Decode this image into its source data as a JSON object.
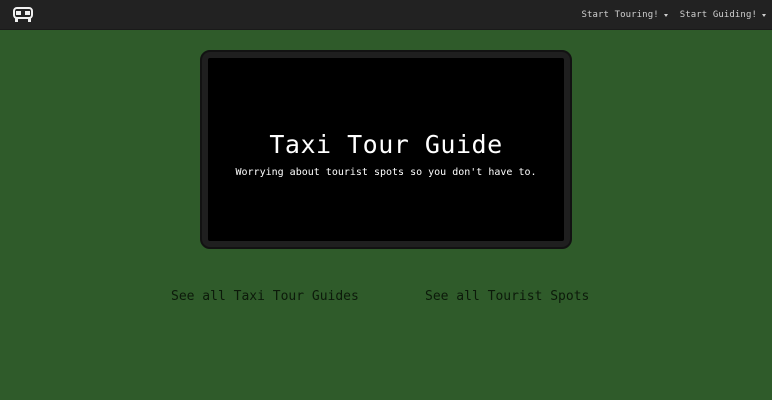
{
  "navbar": {
    "brand_icon": "taxi-icon",
    "menu": [
      {
        "label": "Start Touring!",
        "icon": "caret-down-icon"
      },
      {
        "label": "Start Guiding!",
        "icon": "caret-down-icon"
      }
    ]
  },
  "hero": {
    "title": "Taxi Tour Guide",
    "subtitle": "Worrying about tourist spots so you don't have to."
  },
  "links": {
    "guides": "See all Taxi Tour Guides",
    "spots": "See all Tourist Spots"
  },
  "colors": {
    "background": "#2f5b2a",
    "navbar": "#222222",
    "screen": "#000000",
    "frame": "#1f1f1f",
    "link_text": "#0c1a0a"
  }
}
